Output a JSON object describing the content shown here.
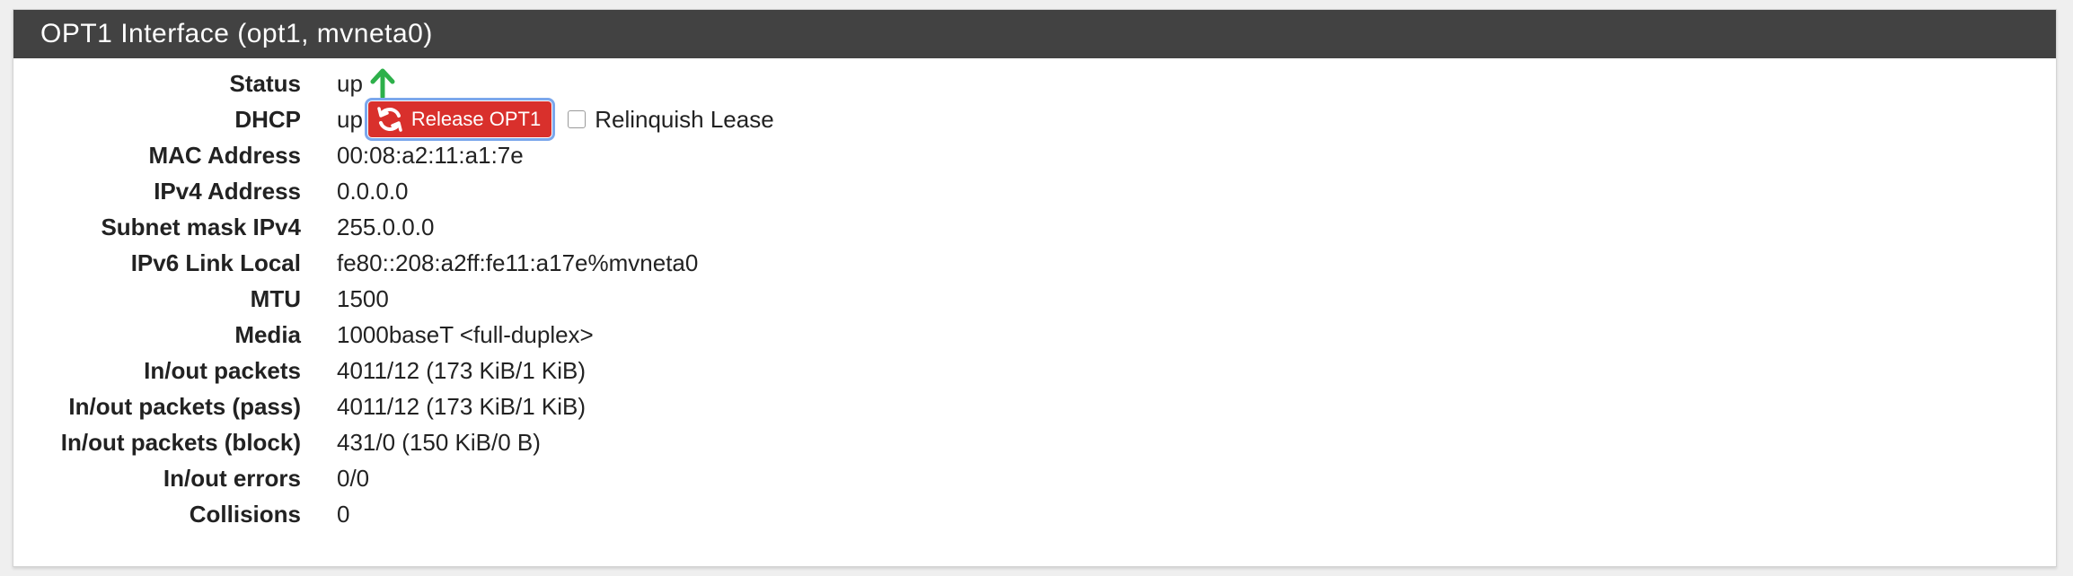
{
  "panel": {
    "title": "OPT1 Interface (opt1, mvneta0)"
  },
  "rows": [
    {
      "label": "Status",
      "value": "up"
    },
    {
      "label": "DHCP",
      "value": "up"
    },
    {
      "label": "MAC Address",
      "value": "00:08:a2:11:a1:7e"
    },
    {
      "label": "IPv4 Address",
      "value": "0.0.0.0"
    },
    {
      "label": "Subnet mask IPv4",
      "value": "255.0.0.0"
    },
    {
      "label": "IPv6 Link Local",
      "value": "fe80::208:a2ff:fe11:a17e%mvneta0"
    },
    {
      "label": "MTU",
      "value": "1500"
    },
    {
      "label": "Media",
      "value": "1000baseT <full-duplex>"
    },
    {
      "label": "In/out packets",
      "value": "4011/12 (173 KiB/1 KiB)"
    },
    {
      "label": "In/out packets (pass)",
      "value": "4011/12 (173 KiB/1 KiB)"
    },
    {
      "label": "In/out packets (block)",
      "value": "431/0 (150 KiB/0 B)"
    },
    {
      "label": "In/out errors",
      "value": "0/0"
    },
    {
      "label": "Collisions",
      "value": "0"
    }
  ],
  "dhcp": {
    "release_label": "Release OPT1",
    "relinquish_label": "Relinquish Lease",
    "relinquish_checked": false
  },
  "icons": {
    "status": "arrow-up-icon",
    "release": "refresh-icon"
  },
  "colors": {
    "header_bg": "#424242",
    "status_up": "#2db04a",
    "release_button": "#d9302c",
    "focus_ring": "#7ba7ec"
  }
}
